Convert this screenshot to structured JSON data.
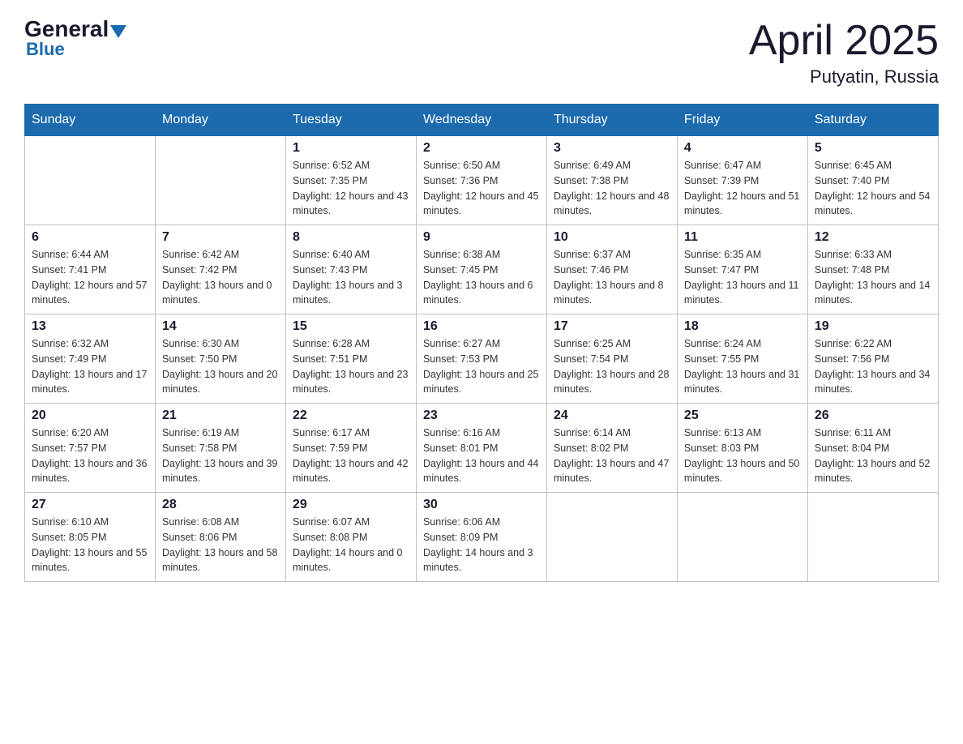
{
  "header": {
    "logo_general": "General",
    "logo_blue": "Blue",
    "month_year": "April 2025",
    "location": "Putyatin, Russia"
  },
  "days_of_week": [
    "Sunday",
    "Monday",
    "Tuesday",
    "Wednesday",
    "Thursday",
    "Friday",
    "Saturday"
  ],
  "weeks": [
    [
      {
        "day": "",
        "sunrise": "",
        "sunset": "",
        "daylight": ""
      },
      {
        "day": "",
        "sunrise": "",
        "sunset": "",
        "daylight": ""
      },
      {
        "day": "1",
        "sunrise": "Sunrise: 6:52 AM",
        "sunset": "Sunset: 7:35 PM",
        "daylight": "Daylight: 12 hours and 43 minutes."
      },
      {
        "day": "2",
        "sunrise": "Sunrise: 6:50 AM",
        "sunset": "Sunset: 7:36 PM",
        "daylight": "Daylight: 12 hours and 45 minutes."
      },
      {
        "day": "3",
        "sunrise": "Sunrise: 6:49 AM",
        "sunset": "Sunset: 7:38 PM",
        "daylight": "Daylight: 12 hours and 48 minutes."
      },
      {
        "day": "4",
        "sunrise": "Sunrise: 6:47 AM",
        "sunset": "Sunset: 7:39 PM",
        "daylight": "Daylight: 12 hours and 51 minutes."
      },
      {
        "day": "5",
        "sunrise": "Sunrise: 6:45 AM",
        "sunset": "Sunset: 7:40 PM",
        "daylight": "Daylight: 12 hours and 54 minutes."
      }
    ],
    [
      {
        "day": "6",
        "sunrise": "Sunrise: 6:44 AM",
        "sunset": "Sunset: 7:41 PM",
        "daylight": "Daylight: 12 hours and 57 minutes."
      },
      {
        "day": "7",
        "sunrise": "Sunrise: 6:42 AM",
        "sunset": "Sunset: 7:42 PM",
        "daylight": "Daylight: 13 hours and 0 minutes."
      },
      {
        "day": "8",
        "sunrise": "Sunrise: 6:40 AM",
        "sunset": "Sunset: 7:43 PM",
        "daylight": "Daylight: 13 hours and 3 minutes."
      },
      {
        "day": "9",
        "sunrise": "Sunrise: 6:38 AM",
        "sunset": "Sunset: 7:45 PM",
        "daylight": "Daylight: 13 hours and 6 minutes."
      },
      {
        "day": "10",
        "sunrise": "Sunrise: 6:37 AM",
        "sunset": "Sunset: 7:46 PM",
        "daylight": "Daylight: 13 hours and 8 minutes."
      },
      {
        "day": "11",
        "sunrise": "Sunrise: 6:35 AM",
        "sunset": "Sunset: 7:47 PM",
        "daylight": "Daylight: 13 hours and 11 minutes."
      },
      {
        "day": "12",
        "sunrise": "Sunrise: 6:33 AM",
        "sunset": "Sunset: 7:48 PM",
        "daylight": "Daylight: 13 hours and 14 minutes."
      }
    ],
    [
      {
        "day": "13",
        "sunrise": "Sunrise: 6:32 AM",
        "sunset": "Sunset: 7:49 PM",
        "daylight": "Daylight: 13 hours and 17 minutes."
      },
      {
        "day": "14",
        "sunrise": "Sunrise: 6:30 AM",
        "sunset": "Sunset: 7:50 PM",
        "daylight": "Daylight: 13 hours and 20 minutes."
      },
      {
        "day": "15",
        "sunrise": "Sunrise: 6:28 AM",
        "sunset": "Sunset: 7:51 PM",
        "daylight": "Daylight: 13 hours and 23 minutes."
      },
      {
        "day": "16",
        "sunrise": "Sunrise: 6:27 AM",
        "sunset": "Sunset: 7:53 PM",
        "daylight": "Daylight: 13 hours and 25 minutes."
      },
      {
        "day": "17",
        "sunrise": "Sunrise: 6:25 AM",
        "sunset": "Sunset: 7:54 PM",
        "daylight": "Daylight: 13 hours and 28 minutes."
      },
      {
        "day": "18",
        "sunrise": "Sunrise: 6:24 AM",
        "sunset": "Sunset: 7:55 PM",
        "daylight": "Daylight: 13 hours and 31 minutes."
      },
      {
        "day": "19",
        "sunrise": "Sunrise: 6:22 AM",
        "sunset": "Sunset: 7:56 PM",
        "daylight": "Daylight: 13 hours and 34 minutes."
      }
    ],
    [
      {
        "day": "20",
        "sunrise": "Sunrise: 6:20 AM",
        "sunset": "Sunset: 7:57 PM",
        "daylight": "Daylight: 13 hours and 36 minutes."
      },
      {
        "day": "21",
        "sunrise": "Sunrise: 6:19 AM",
        "sunset": "Sunset: 7:58 PM",
        "daylight": "Daylight: 13 hours and 39 minutes."
      },
      {
        "day": "22",
        "sunrise": "Sunrise: 6:17 AM",
        "sunset": "Sunset: 7:59 PM",
        "daylight": "Daylight: 13 hours and 42 minutes."
      },
      {
        "day": "23",
        "sunrise": "Sunrise: 6:16 AM",
        "sunset": "Sunset: 8:01 PM",
        "daylight": "Daylight: 13 hours and 44 minutes."
      },
      {
        "day": "24",
        "sunrise": "Sunrise: 6:14 AM",
        "sunset": "Sunset: 8:02 PM",
        "daylight": "Daylight: 13 hours and 47 minutes."
      },
      {
        "day": "25",
        "sunrise": "Sunrise: 6:13 AM",
        "sunset": "Sunset: 8:03 PM",
        "daylight": "Daylight: 13 hours and 50 minutes."
      },
      {
        "day": "26",
        "sunrise": "Sunrise: 6:11 AM",
        "sunset": "Sunset: 8:04 PM",
        "daylight": "Daylight: 13 hours and 52 minutes."
      }
    ],
    [
      {
        "day": "27",
        "sunrise": "Sunrise: 6:10 AM",
        "sunset": "Sunset: 8:05 PM",
        "daylight": "Daylight: 13 hours and 55 minutes."
      },
      {
        "day": "28",
        "sunrise": "Sunrise: 6:08 AM",
        "sunset": "Sunset: 8:06 PM",
        "daylight": "Daylight: 13 hours and 58 minutes."
      },
      {
        "day": "29",
        "sunrise": "Sunrise: 6:07 AM",
        "sunset": "Sunset: 8:08 PM",
        "daylight": "Daylight: 14 hours and 0 minutes."
      },
      {
        "day": "30",
        "sunrise": "Sunrise: 6:06 AM",
        "sunset": "Sunset: 8:09 PM",
        "daylight": "Daylight: 14 hours and 3 minutes."
      },
      {
        "day": "",
        "sunrise": "",
        "sunset": "",
        "daylight": ""
      },
      {
        "day": "",
        "sunrise": "",
        "sunset": "",
        "daylight": ""
      },
      {
        "day": "",
        "sunrise": "",
        "sunset": "",
        "daylight": ""
      }
    ]
  ]
}
